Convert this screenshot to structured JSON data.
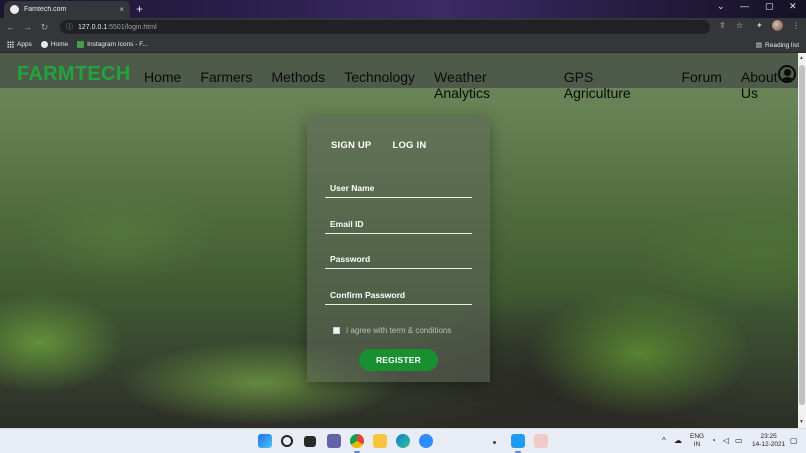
{
  "browser": {
    "tab_title": "Famtech.com",
    "tab_close": "×",
    "new_tab": "+",
    "url_host": "127.0.0.1",
    "url_path": ":5501/login.html",
    "bookmarks": [
      {
        "label": "Apps",
        "icon": "apps-grid-icon"
      },
      {
        "label": "Home",
        "icon": "globe-icon"
      },
      {
        "label": "Instagram Icons - F...",
        "icon": "instagram-icon"
      }
    ],
    "reading_list": "Reading list"
  },
  "navbar": {
    "brand": "FARMTECH",
    "links": [
      "Home",
      "Farmers",
      "Methods",
      "Technology",
      "Weather Analytics",
      "GPS Agriculture",
      "Forum",
      "About Us"
    ],
    "brand_color": "#1fa53c"
  },
  "form": {
    "tab_signup": "SIGN UP",
    "tab_login": "LOG IN",
    "user_name": "User Name",
    "email": "Email ID",
    "password": "Password",
    "confirm_password": "Confirm Password",
    "agree": "I agree with term & conditions",
    "register": "REGISTER",
    "button_color": "#189032"
  },
  "taskbar": {
    "lang_top": "ENG",
    "lang_bottom": "IN",
    "time": "23:25",
    "date": "14-12-2021"
  }
}
